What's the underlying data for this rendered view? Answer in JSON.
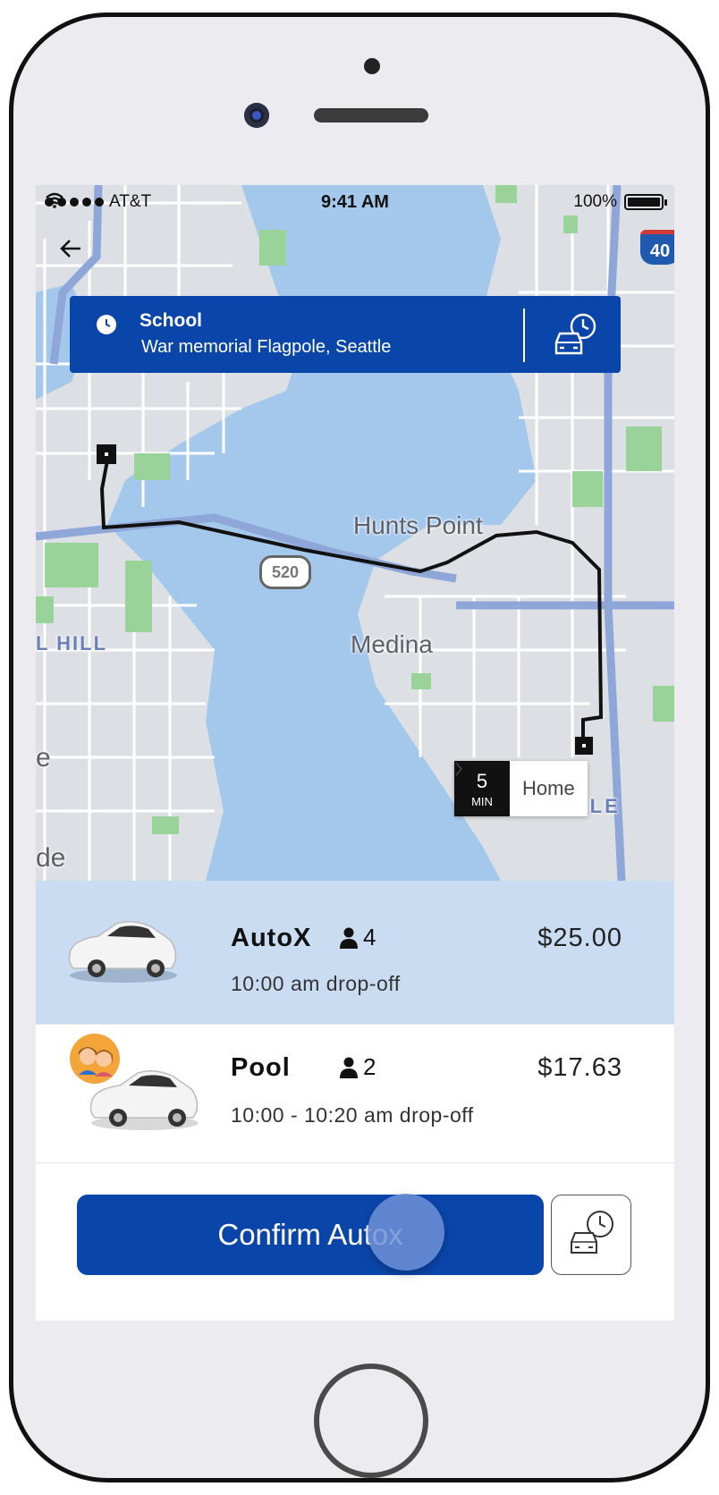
{
  "status_bar": {
    "carrier": "AT&T",
    "time": "9:41 AM",
    "battery": "100%"
  },
  "destination": {
    "title": "School",
    "subtitle": "War memorial Flagpole, Seattle"
  },
  "map": {
    "labels": {
      "hunts_point": "Hunts Point",
      "medina": "Medina",
      "hill": "L HILL",
      "west_belle": "WEST BELLE",
      "highway_520": "520",
      "interstate": "40",
      "edge_e": "e",
      "edge_de": "de"
    },
    "eta": {
      "minutes": "5",
      "unit": "MIN",
      "place": "Home"
    }
  },
  "rides": [
    {
      "name": "AutoX",
      "seats": "4",
      "price": "$25.00",
      "dropoff": "10:00 am drop-off",
      "selected": true
    },
    {
      "name": "Pool",
      "seats": "2",
      "price": "$17.63",
      "dropoff": "10:00 - 10:20 am drop-off",
      "selected": false
    }
  ],
  "confirm": {
    "label": "Confirm Autox"
  },
  "colors": {
    "brand_blue": "#0a46aa",
    "selected_row": "#c9dcf2",
    "water": "#a4c8ec",
    "park": "#9ad39a"
  }
}
